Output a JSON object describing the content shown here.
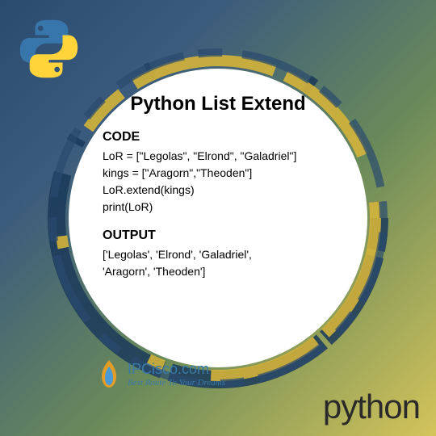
{
  "title": "Python List Extend",
  "code_label": "CODE",
  "code_lines": [
    "LoR = [\"Legolas\", \"Elrond\", \"Galadriel\"]",
    "kings = [\"Aragorn\",\"Theoden\"]",
    "LoR.extend(kings)",
    "print(LoR)"
  ],
  "output_label": "OUTPUT",
  "output_lines": [
    "['Legolas', 'Elrond', 'Galadriel',",
    "'Aragorn', 'Theoden']"
  ],
  "brand": {
    "name": "IPCisco.com",
    "tagline": "Best Route To Your Dreams"
  },
  "footer_text": "python"
}
